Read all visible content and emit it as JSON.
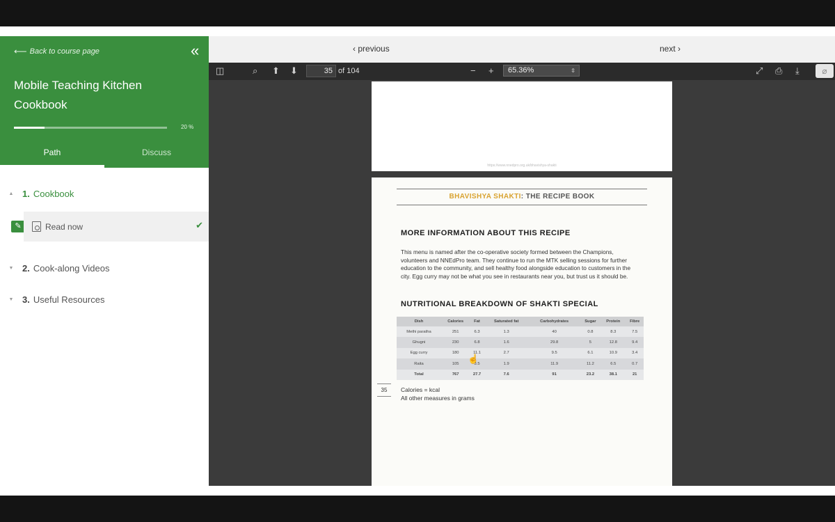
{
  "sidebar": {
    "back_label": "Back to course page",
    "course_title": "Mobile Teaching Kitchen Cookbook",
    "progress": {
      "percent": 20,
      "label": "20 %"
    },
    "tabs": [
      {
        "label": "Path",
        "active": true
      },
      {
        "label": "Discuss",
        "active": false
      }
    ],
    "sections": [
      {
        "num": "1.",
        "label": "Cookbook",
        "expanded": true
      },
      {
        "num": "2.",
        "label": "Cook-along Videos",
        "expanded": false
      },
      {
        "num": "3.",
        "label": "Useful Resources",
        "expanded": false
      }
    ],
    "lesson": {
      "label": "Read now",
      "completed": true
    }
  },
  "navigation": {
    "previous_label": "previous",
    "next_label": "next"
  },
  "pdf_toolbar": {
    "current_page": "35",
    "page_total": "of 104",
    "zoom": "65.36%"
  },
  "document": {
    "top_page_url": "https://www.nnedpro.org.uk/bhavishya-shakti",
    "book_title_accent": "BHAVISHYA SHAKTI",
    "book_title_rest": ": THE RECIPE BOOK",
    "more_info_heading": "MORE INFORMATION ABOUT THIS RECIPE",
    "more_info_text": "This menu is named after the co-operative society formed between the Champions, volunteers and NNEdPro team. They continue to run the MTK selling sessions for further education to the community, and sell healthy food alongside education to customers in the city. Egg curry may not be what you see in restaurants near you, but trust us it should be.",
    "nutrition_heading": "NUTRITIONAL BREAKDOWN OF SHAKTI SPECIAL",
    "table": {
      "headers": [
        "Dish",
        "Calories",
        "Fat",
        "Saturated fat",
        "Carbohydrates",
        "Sugar",
        "Protein",
        "Fibre"
      ],
      "rows": [
        [
          "Methi paratha",
          "251",
          "6.3",
          "1.3",
          "40",
          "0.8",
          "8.3",
          "7.5"
        ],
        [
          "Ghugni",
          "230",
          "6.8",
          "1.6",
          "29.8",
          "5",
          "12.8",
          "9.4"
        ],
        [
          "Egg curry",
          "180",
          "11.1",
          "2.7",
          "9.5",
          "6.1",
          "10.9",
          "3.4"
        ],
        [
          "Raita",
          "105",
          "3.5",
          "1.9",
          "11.9",
          "11.2",
          "6.5",
          "0.7"
        ],
        [
          "Total",
          "767",
          "27.7",
          "7.6",
          "91",
          "23.2",
          "38.1",
          "21"
        ]
      ]
    },
    "page_number": "35",
    "note_calories": "Calories = kcal",
    "note_measures": "All other measures in grams"
  }
}
